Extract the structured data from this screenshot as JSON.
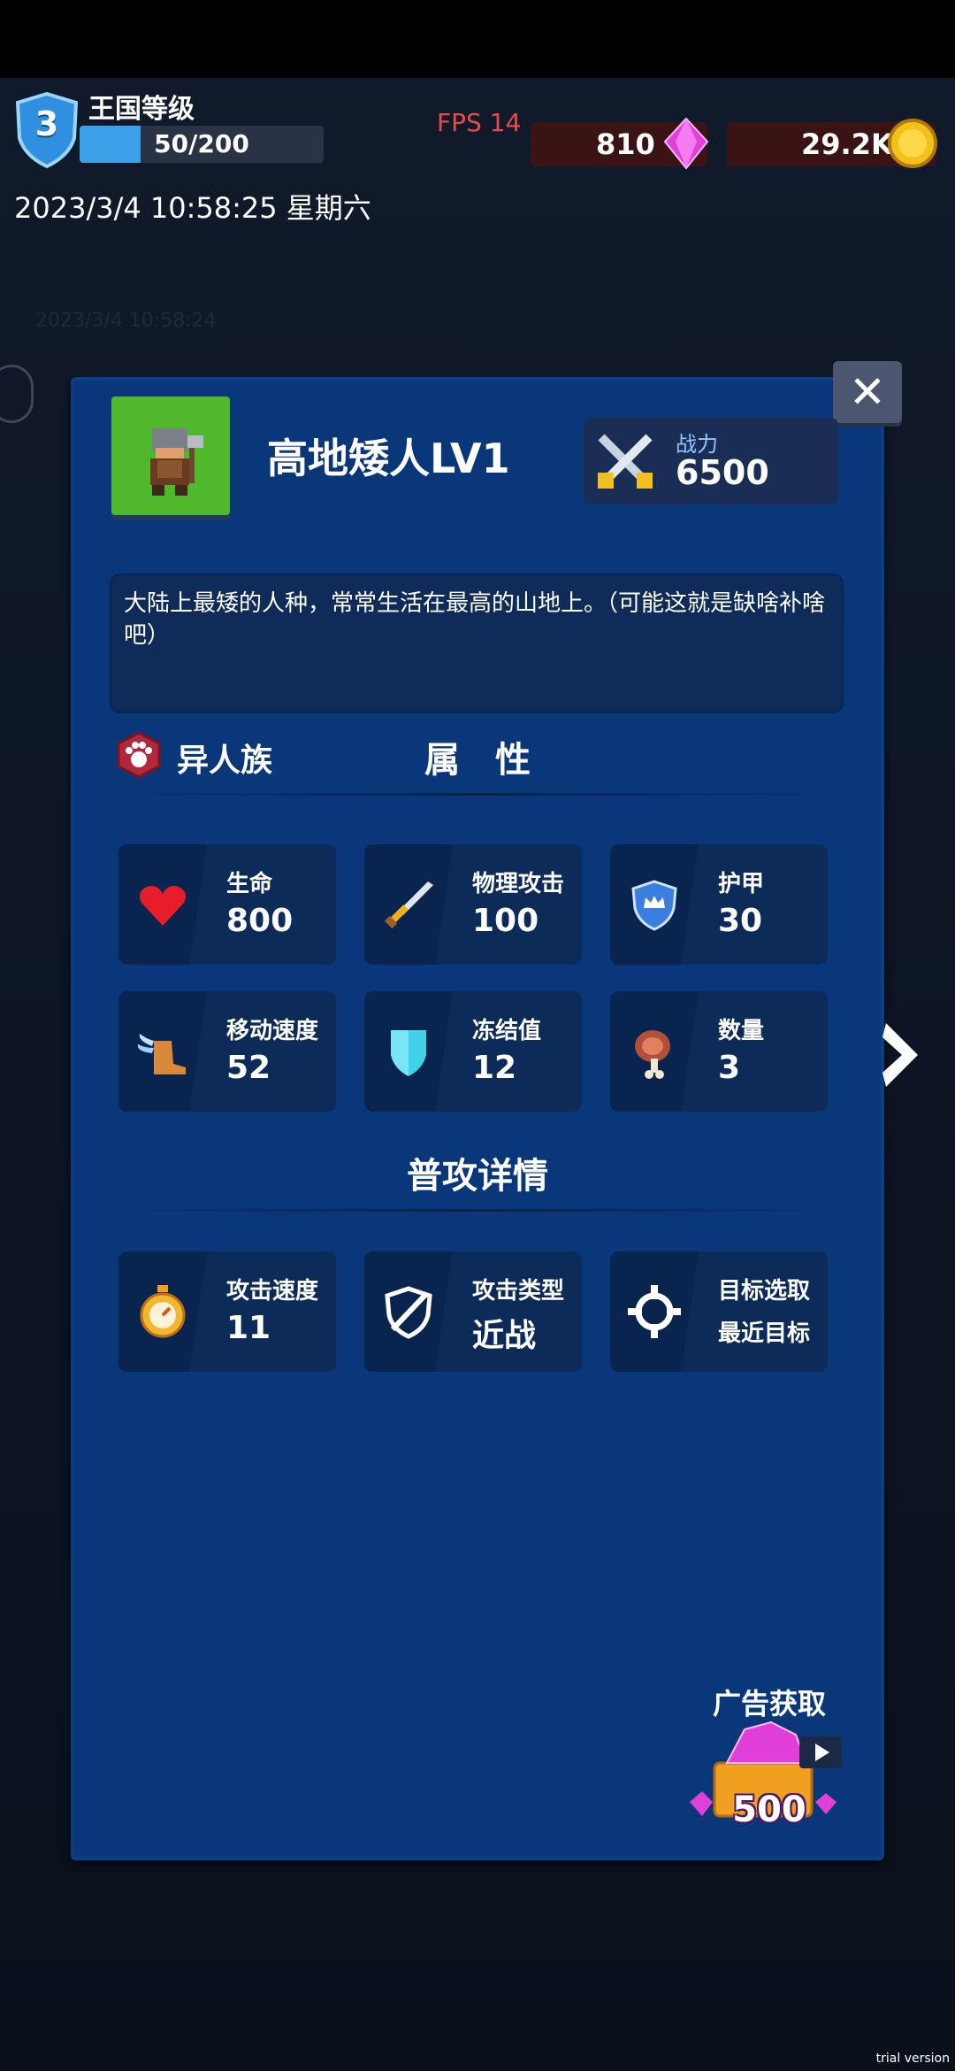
{
  "header": {
    "level_title": "王国等级",
    "level": "3",
    "xp_text": "50/200",
    "xp_progress": 0.25,
    "datetime": "2023/3/4 10:58:25 星期六",
    "fps": "FPS 14",
    "gems": "810",
    "gold": "29.2K"
  },
  "unit": {
    "name": "高地矮人LV1",
    "power_label": "战力",
    "power_value": "6500",
    "description": "大陆上最矮的人种，常常生活在最高的山地上。（可能这就是缺啥补啥吧）",
    "race": "异人族"
  },
  "sections": {
    "attributes": "属　性",
    "attack_details": "普攻详情"
  },
  "attributes": [
    {
      "label": "生命",
      "value": "800",
      "icon": "heart-icon"
    },
    {
      "label": "物理攻击",
      "value": "100",
      "icon": "sword-icon"
    },
    {
      "label": "护甲",
      "value": "30",
      "icon": "shield-crown-icon"
    },
    {
      "label": "移动速度",
      "value": "52",
      "icon": "winged-boot-icon"
    },
    {
      "label": "冻结值",
      "value": "12",
      "icon": "ice-shield-icon"
    },
    {
      "label": "数量",
      "value": "3",
      "icon": "meat-icon"
    }
  ],
  "attack": [
    {
      "label": "攻击速度",
      "value": "11",
      "icon": "stopwatch-icon"
    },
    {
      "label": "攻击类型",
      "value": "近战",
      "icon": "sword-shield-icon"
    },
    {
      "label": "目标选取",
      "value": "最近目标",
      "icon": "crosshair-icon"
    }
  ],
  "ad": {
    "label": "广告获取",
    "amount": "500"
  },
  "watermark": "trial version",
  "colors": {
    "panel": "#09377a",
    "gem": "#e040d8",
    "gold": "#f2c21a",
    "fps": "#e84b4b",
    "power_label": "#8fc6ff"
  }
}
